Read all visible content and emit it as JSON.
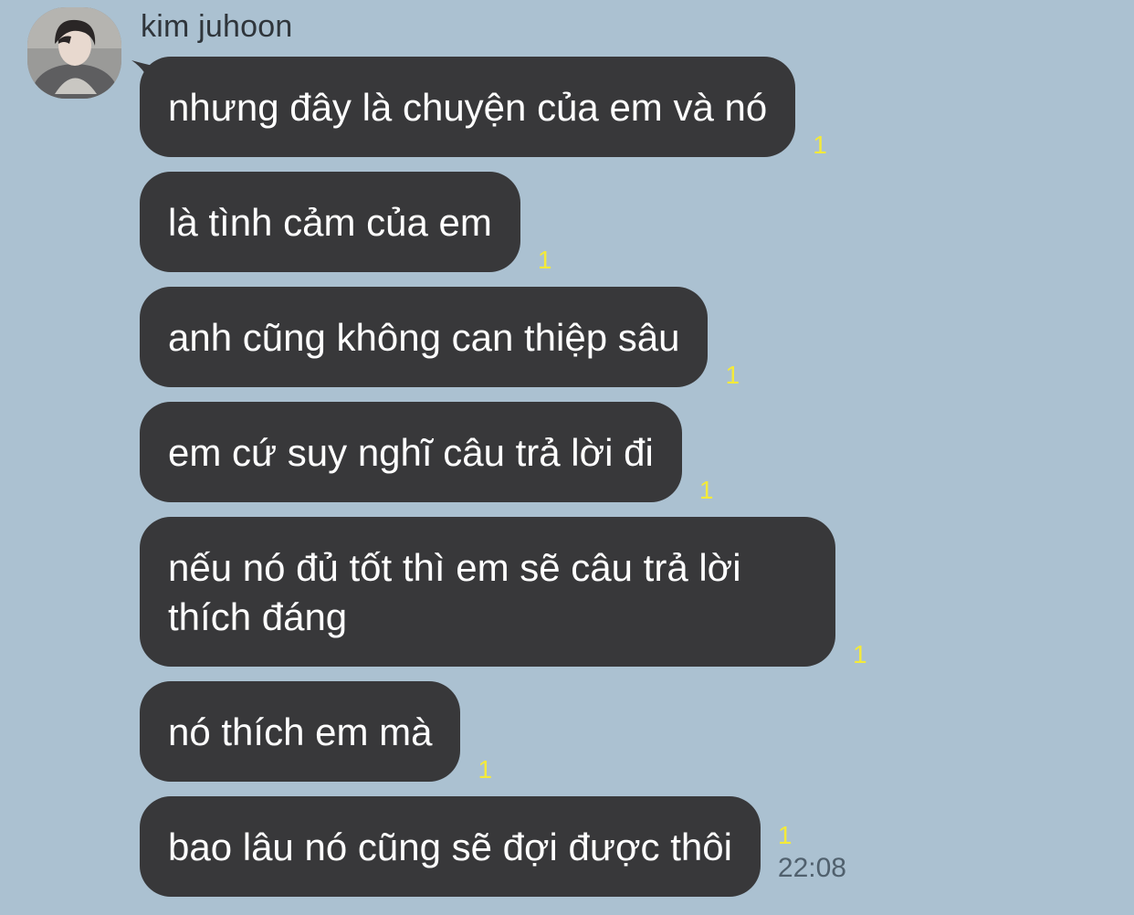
{
  "chat": {
    "sender_name": "kim juhoon",
    "colors": {
      "background": "#abc1d1",
      "bubble": "#38383a",
      "bubble_text": "#ffffff",
      "unread": "#f4ea3a",
      "time": "#50606d"
    },
    "messages": [
      {
        "text": "nhưng đây là chuyện của em và nó",
        "unread": "1"
      },
      {
        "text": "là tình cảm của em",
        "unread": "1"
      },
      {
        "text": "anh cũng không can thiệp sâu",
        "unread": "1"
      },
      {
        "text": "em cứ suy nghĩ câu trả lời đi",
        "unread": "1"
      },
      {
        "text": "nếu nó đủ tốt thì em sẽ câu trả lời thích đáng",
        "unread": "1"
      },
      {
        "text": "nó thích em mà",
        "unread": "1"
      },
      {
        "text": "bao lâu nó cũng sẽ đợi được thôi",
        "unread": "1",
        "time": "22:08"
      }
    ]
  }
}
